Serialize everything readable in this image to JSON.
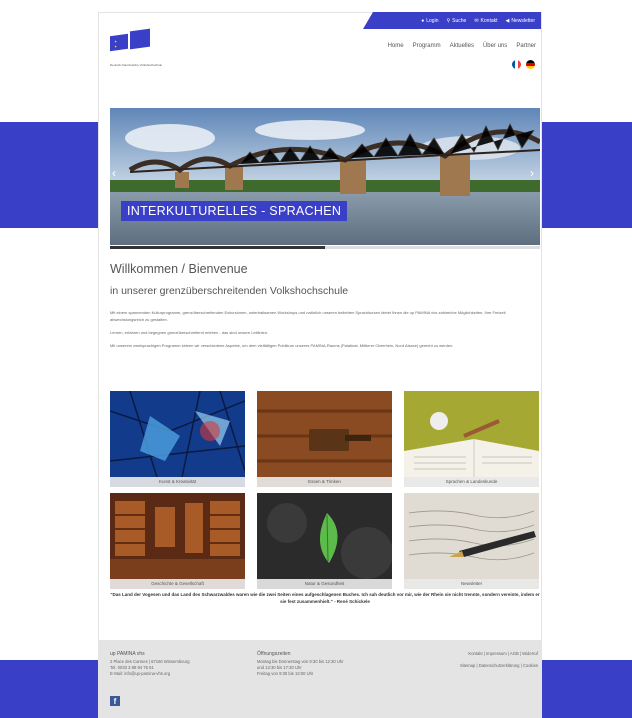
{
  "header": {
    "top_links": [
      {
        "icon": "user-icon",
        "label": "Login"
      },
      {
        "icon": "search-icon",
        "label": "Suche"
      },
      {
        "icon": "mail-icon",
        "label": "Kontakt"
      },
      {
        "icon": "send-icon",
        "label": "Newsletter"
      }
    ],
    "logo_tagline": "Deutsch-französische Volkshochschule",
    "nav": [
      "Home",
      "Programm",
      "Aktuelles",
      "Über uns",
      "Partner"
    ],
    "languages": [
      "fr",
      "de"
    ]
  },
  "hero": {
    "title": "INTERKULTURELLES - SPRACHEN",
    "slide_progress": 0.5
  },
  "main": {
    "heading": "Willkommen / Bienvenue",
    "subheading": "in unserer grenzüberschreitenden Volkshochschule",
    "paragraphs": [
      "Mit einem spannenden Kulturprogramm, grenzüberschreitenden Exkursionen, unterhaltsamen Workshops und natürlich unseren beliebten Sprachkursen bietet Ihnen die up PAMINA vhs zahlreiche Möglichkeiten, Ihre Freizeit abwechslungsreich zu gestalten.",
      "Lernen, erfahren und begegnen grenzüberschreitend erleben - das sind unsere Leitlinien.",
      "Mit unserem zweisprachigen Programm setzen wir verschiedene Aspekte, um dem vielfältigen Publikum unseres PAMINA-Raums (Palatinat, Mittlerer Oberrhein, Nord Alsace) gerecht zu werden."
    ]
  },
  "tiles": [
    {
      "label": "Kunst & Kreativität"
    },
    {
      "label": "Essen & Trinken"
    },
    {
      "label": "Sprachen & Landeskunde"
    },
    {
      "label": "Geschichte & Gesellschaft"
    },
    {
      "label": "Natur & Gesundheit"
    },
    {
      "label": "Newsletter"
    }
  ],
  "quote": {
    "text": "\"Das Land der Vogesen und das Land des Schwarzwaldes waren wie die zwei Seiten eines aufgeschlagenen Buches. Ich sah deutlich vor mir, wie der Rhein sie nicht trennte, sondern vereinte, indem er sie fest zusammenhielt.\"",
    "author": "- René Schickele"
  },
  "footer": {
    "col1": {
      "heading": "up PAMINA vhs",
      "lines": [
        "2 Place des Carmes | 67160 Wissembourg",
        "Tel. 0033 3 88 94 76 61",
        "E-Mail: info@up-pamina-vhs.org"
      ]
    },
    "col2": {
      "heading": "Öffnungszeiten",
      "lines": [
        "Montag bis Donnerstag von 9:30 bis 12:30 Uhr",
        "und 13:30 bis 17:30 Uhr",
        "Freitag von 9:30 bis 13:00 Uhr"
      ]
    },
    "links_row1": "Kontakt | Impressum | AGB | Widerruf",
    "links_row2": "Sitemap | Datenschutzerklärung | Cookies",
    "social_icon": "facebook-icon"
  },
  "colors": {
    "accent": "#3a3fc7",
    "footer_bg": "#e4e4e4"
  }
}
